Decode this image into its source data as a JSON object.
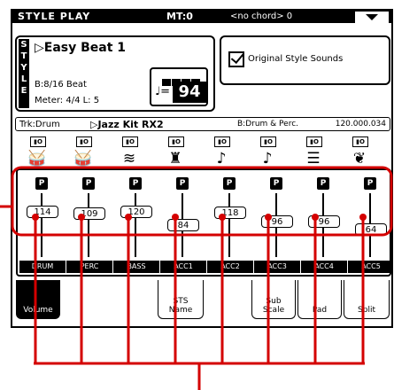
{
  "topbar": {
    "title": "STYLE PLAY",
    "mt": "MT:0",
    "chord": "<no chord> 0"
  },
  "style": {
    "vertical_label": [
      "S",
      "T",
      "Y",
      "L",
      "E"
    ],
    "name": "▷Easy Beat 1",
    "beat": "B:8/16 Beat",
    "meter": "Meter: 4/4  L: 5",
    "tempo_note": "♩=",
    "tempo": "94"
  },
  "original_style_sounds": {
    "label": "Original Style Sounds",
    "checked": true
  },
  "track": {
    "label": "Trk:Drum",
    "kit": "▷Jazz Kit RX2",
    "bank": "B:Drum & Perc.",
    "number": "120.000.034"
  },
  "instruments": [
    {
      "icon": "drum-kit-icon",
      "glyph": "⬤"
    },
    {
      "icon": "percussion-icon",
      "glyph": "⬤"
    },
    {
      "icon": "bass-icon",
      "glyph": "≡"
    },
    {
      "icon": "piano-icon",
      "glyph": "♜"
    },
    {
      "icon": "guitar-icon",
      "glyph": "♪"
    },
    {
      "icon": "guitar-icon",
      "glyph": "♪"
    },
    {
      "icon": "organ-icon",
      "glyph": "☰"
    },
    {
      "icon": "strings-icon",
      "glyph": "❦"
    }
  ],
  "mixer": {
    "play_label": "P",
    "channels": [
      {
        "name": "DRUM",
        "volume": "114"
      },
      {
        "name": "PERC",
        "volume": "109"
      },
      {
        "name": "BASS",
        "volume": "120"
      },
      {
        "name": "ACC1",
        "volume": "84"
      },
      {
        "name": "ACC2",
        "volume": "118"
      },
      {
        "name": "ACC3",
        "volume": "96"
      },
      {
        "name": "ACC4",
        "volume": "96"
      },
      {
        "name": "ACC5",
        "volume": "64"
      }
    ]
  },
  "tabs": [
    {
      "label": "Volume"
    },
    {
      "label": ""
    },
    {
      "label": ""
    },
    {
      "label": "STS\nName"
    },
    {
      "label": ""
    },
    {
      "label": "Sub\nScale"
    },
    {
      "label": "Pad"
    },
    {
      "label": "Split"
    }
  ]
}
